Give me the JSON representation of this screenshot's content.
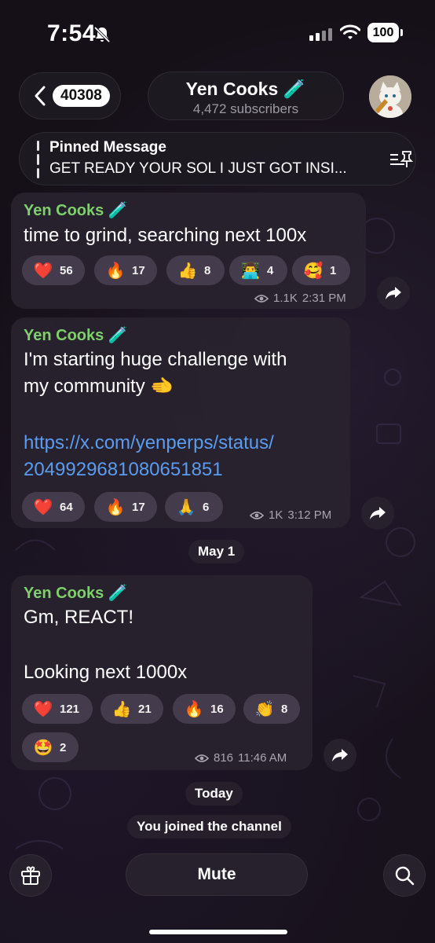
{
  "status_bar": {
    "time": "7:54",
    "battery": "100"
  },
  "header": {
    "back_count": "40308",
    "channel_name": "Yen Cooks",
    "channel_emoji": "🧪",
    "subscribers": "4,472 subscribers"
  },
  "pinned": {
    "label": "Pinned Message",
    "text": "GET READY YOUR SOL I JUST GOT INSI..."
  },
  "messages": [
    {
      "sender": "Yen Cooks 🧪",
      "lines": [
        "time to grind, searching next 100x"
      ],
      "reactions": [
        {
          "emoji": "❤️",
          "count": "56"
        },
        {
          "emoji": "🔥",
          "count": "17"
        },
        {
          "emoji": "👍",
          "count": "8"
        },
        {
          "emoji": "👨‍💻",
          "count": "4"
        },
        {
          "emoji": "🥰",
          "count": "1"
        }
      ],
      "views": "1.1K",
      "time": "2:31 PM"
    },
    {
      "sender": "Yen Cooks 🧪",
      "lines": [
        "I'm starting huge challenge with",
        "my community 🫲"
      ],
      "link_lines": [
        "https://x.com/yenperps/status/",
        "2049929681080651851"
      ],
      "reactions": [
        {
          "emoji": "❤️",
          "count": "64"
        },
        {
          "emoji": "🔥",
          "count": "17"
        },
        {
          "emoji": "🙏",
          "count": "6"
        }
      ],
      "views": "1K",
      "time": "3:12 PM"
    },
    {
      "sender": "Yen Cooks 🧪",
      "lines": [
        "Gm, REACT!",
        "Looking next 1000x"
      ],
      "reactions": [
        {
          "emoji": "❤️",
          "count": "121"
        },
        {
          "emoji": "👍",
          "count": "21"
        },
        {
          "emoji": "🔥",
          "count": "16"
        },
        {
          "emoji": "👏",
          "count": "8"
        },
        {
          "emoji": "🤩",
          "count": "2"
        }
      ],
      "views": "816",
      "time": "11:46 AM"
    }
  ],
  "date_separators": {
    "may1": "May 1",
    "today": "Today"
  },
  "service_message": "You joined the channel",
  "bottom_bar": {
    "mute_label": "Mute"
  },
  "icons": {
    "bell": "bell-slash-icon",
    "back": "chevron-left-icon",
    "pin": "pin-list-icon",
    "views": "eye-icon",
    "share": "share-arrow-icon",
    "gift": "gift-icon",
    "search": "search-icon"
  },
  "colors": {
    "sender_name": "#7ed06b",
    "link": "#5a9cf0",
    "bubble": "#28222e"
  }
}
